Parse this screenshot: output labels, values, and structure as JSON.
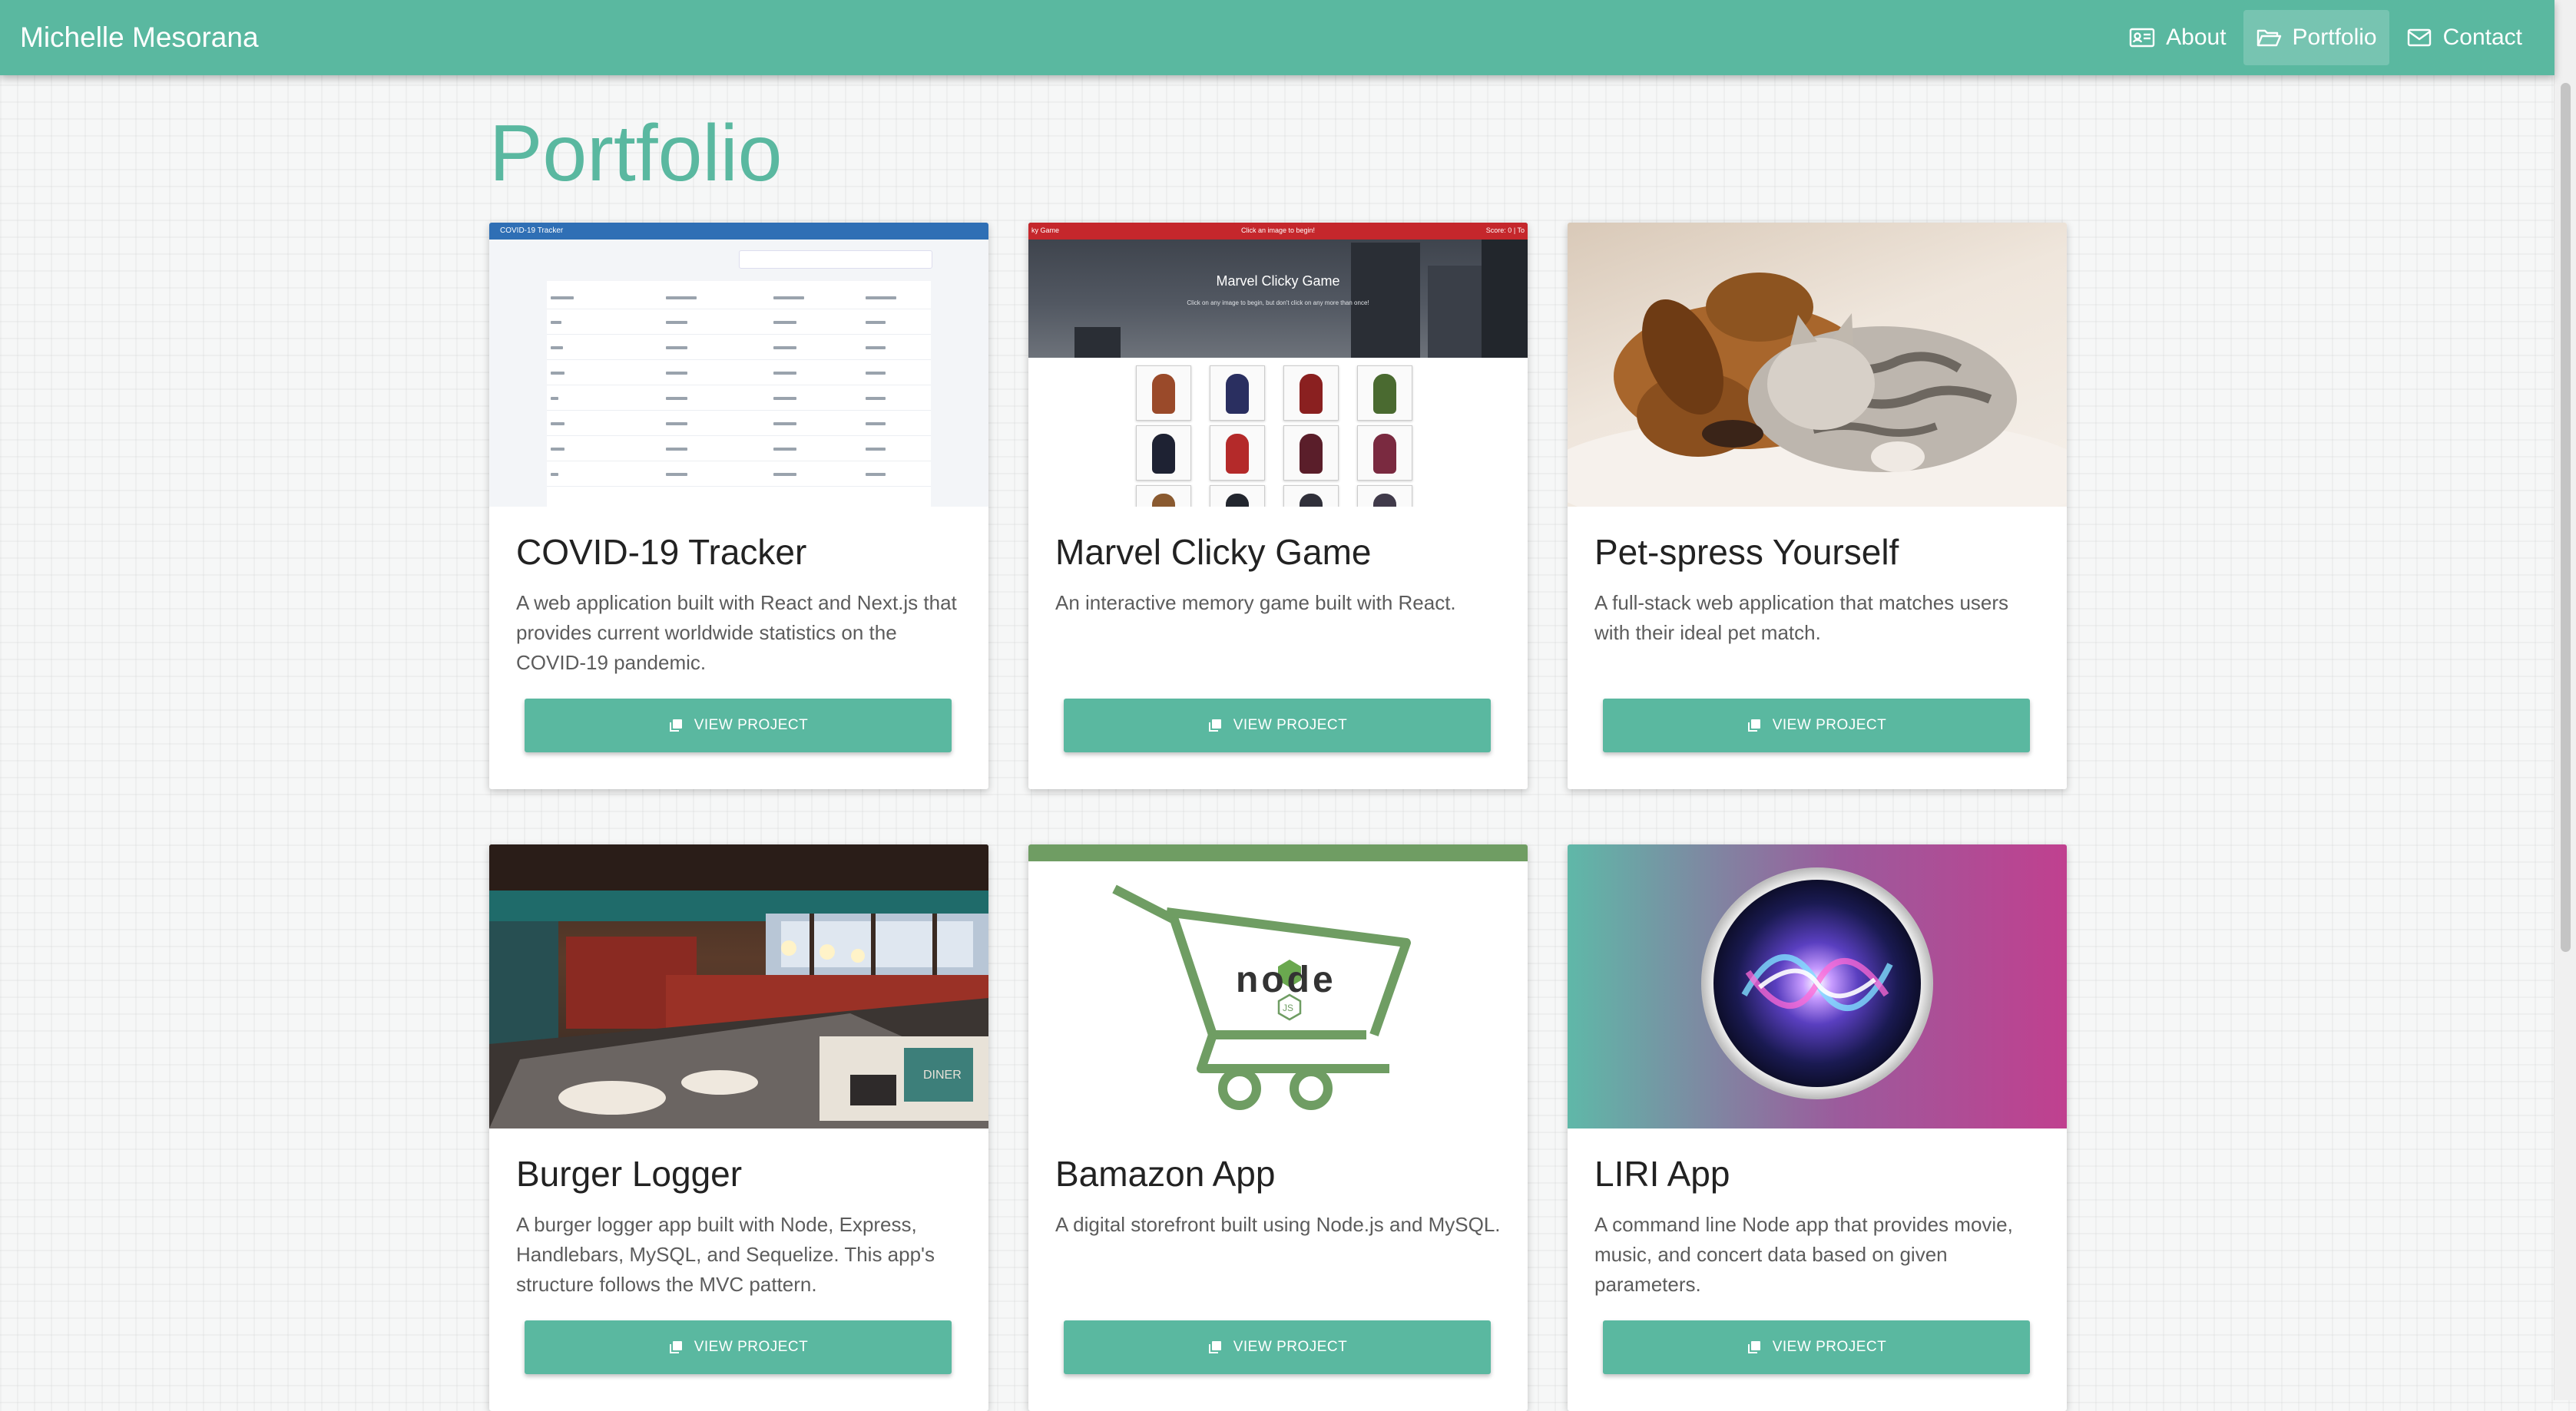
{
  "navbar": {
    "brand": "Michelle Mesorana",
    "items": [
      {
        "label": "About",
        "icon": "id-card-icon"
      },
      {
        "label": "Portfolio",
        "icon": "folder-open-icon",
        "active": true
      },
      {
        "label": "Contact",
        "icon": "envelope-icon"
      }
    ]
  },
  "page": {
    "title": "Portfolio"
  },
  "colors": {
    "accent": "#5ab8a0"
  },
  "projects": [
    {
      "title": "COVID-19 Tracker",
      "description": "A web application built with React and Next.js that provides current worldwide statistics on the COVID-19 pandemic.",
      "button": "VIEW PROJECT",
      "thumb": {
        "header": "COVID-19 Tracker"
      }
    },
    {
      "title": "Marvel Clicky Game",
      "description": "An interactive memory game built with React.",
      "button": "VIEW PROJECT",
      "thumb": {
        "topbar_left": "ky Game",
        "topbar_center": "Click an image to begin!",
        "topbar_right": "Score: 0 | To",
        "heading": "Marvel Clicky Game",
        "subheading": "Click on any image to begin, but don't click on any more than once!"
      }
    },
    {
      "title": "Pet-spress Yourself",
      "description": "A full-stack web application that matches users with their ideal pet match.",
      "button": "VIEW PROJECT"
    },
    {
      "title": "Burger Logger",
      "description": "A burger logger app built with Node, Express, Handlebars, MySQL, and Sequelize. This app's structure follows the MVC pattern.",
      "button": "VIEW PROJECT",
      "thumb": {
        "sign": "DINER"
      }
    },
    {
      "title": "Bamazon App",
      "description": "A digital storefront built using Node.js and MySQL.",
      "button": "VIEW PROJECT",
      "thumb": {
        "logo_text": "node",
        "logo_badge": "JS"
      }
    },
    {
      "title": "LIRI App",
      "description": "A command line Node app that provides movie, music, and concert data based on given parameters.",
      "button": "VIEW PROJECT"
    }
  ]
}
